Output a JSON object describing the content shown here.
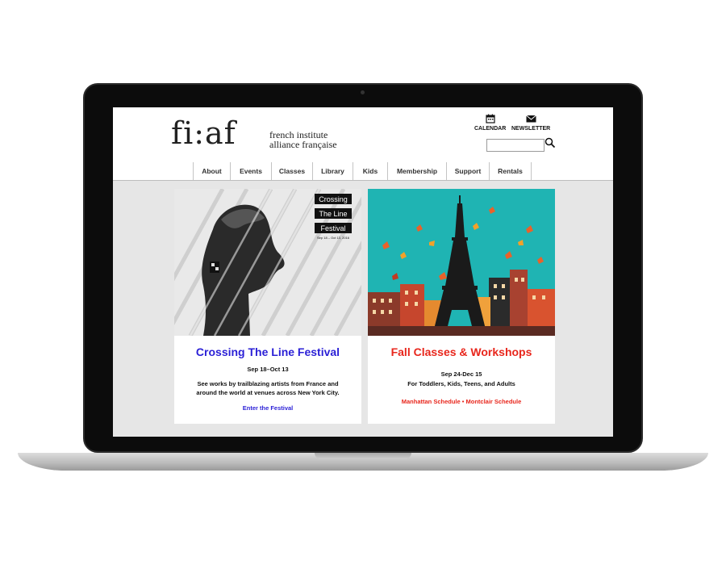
{
  "brand": {
    "logo": "fi:af",
    "tagline_line1": "french institute",
    "tagline_line2": "alliance française"
  },
  "utility": {
    "calendar_label": "CALENDAR",
    "newsletter_label": "NEWSLETTER",
    "search_value": ""
  },
  "nav": [
    {
      "label": "About"
    },
    {
      "label": "Events"
    },
    {
      "label": "Classes"
    },
    {
      "label": "Library"
    },
    {
      "label": "Kids"
    },
    {
      "label": "Membership"
    },
    {
      "label": "Support"
    },
    {
      "label": "Rentals"
    }
  ],
  "cards": [
    {
      "image_text": [
        "Crossing",
        "The Line",
        "Festival"
      ],
      "image_dates": "Sep 18 – Oct 13, 2016",
      "title": "Crossing The Line Festival",
      "dates": "Sep 18–Oct 13",
      "desc_line1": "See works by trailblazing artists from France and",
      "desc_line2": "around the world at venues across New York City.",
      "link": "Enter the Festival",
      "accent": "#2a1fd6"
    },
    {
      "title": "Fall Classes & Workshops",
      "dates": "Sep 24-Dec 15",
      "desc_line1": "For Toddlers, Kids, Teens, and Adults",
      "link_manhattan": "Manhattan Schedule",
      "link_sep": "•",
      "link_montclair": "Montclair Schedule",
      "accent": "#e8261c",
      "sky_color": "#1fb4b3"
    }
  ]
}
